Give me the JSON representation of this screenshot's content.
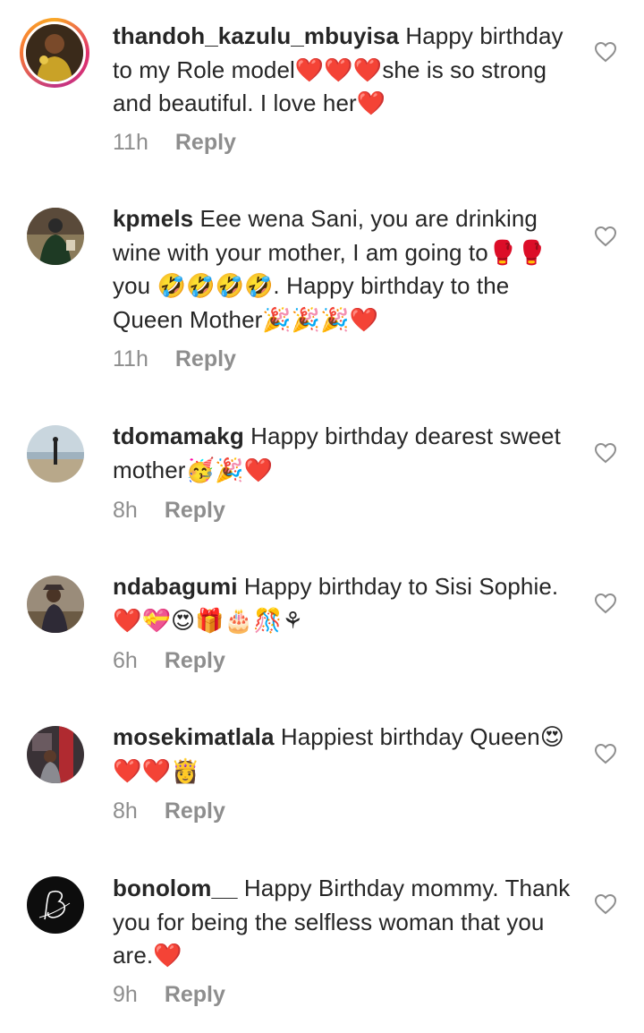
{
  "comments": [
    {
      "username": "thandoh_kazulu_mbuyisa",
      "text": " Happy birthday to my Role model❤️❤️❤️she is so strong and beautiful. I love her❤️",
      "time": "11h",
      "reply": "Reply",
      "avatar_story_ring": true
    },
    {
      "username": "kpmels",
      "text": " Eee wena Sani, you are drinking wine with your mother, I am going to🥊🥊 you 🤣🤣🤣🤣. Happy birthday to the Queen Mother🎉🎉🎉❤️",
      "time": "11h",
      "reply": "Reply"
    },
    {
      "username": "tdomamakg",
      "text": " Happy birthday dearest sweet mother🥳🎉❤️",
      "time": "8h",
      "reply": "Reply"
    },
    {
      "username": "ndabagumi",
      "text": " Happy birthday to Sisi Sophie. ❤️💝😍🎁🎂🎊⚘",
      "time": "6h",
      "reply": "Reply"
    },
    {
      "username": "mosekimatlala",
      "text": " Happiest birthday Queen😍❤️❤️👸",
      "time": "8h",
      "reply": "Reply"
    },
    {
      "username": "bonolom__",
      "text": " Happy Birthday mommy. Thank you for being the selfless woman that you are.❤️",
      "time": "9h",
      "reply": "Reply"
    }
  ],
  "icons": {
    "like": "heart-outline-icon"
  },
  "colors": {
    "text": "#262626",
    "secondary": "#8e8e8e",
    "heart": "#e0242a"
  }
}
